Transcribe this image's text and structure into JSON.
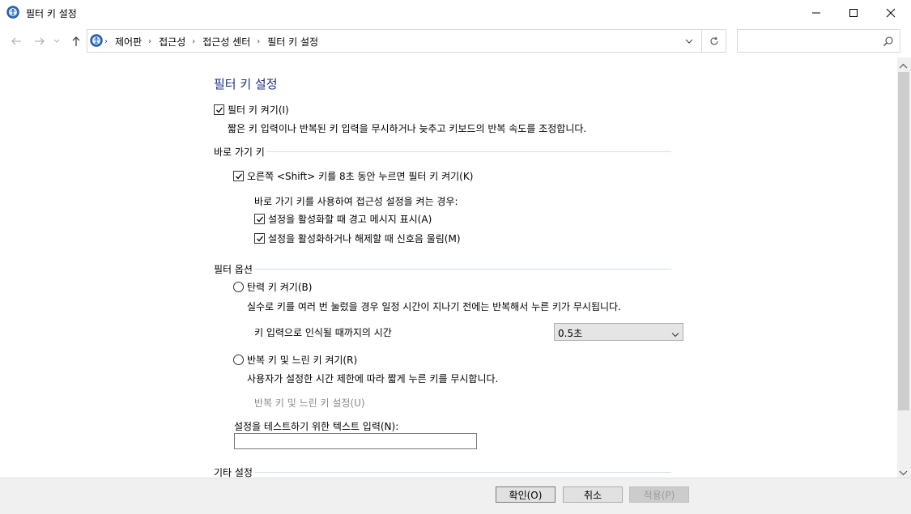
{
  "window": {
    "title": "필터 키 설정"
  },
  "address": {
    "crumbs": [
      "제어판",
      "접근성",
      "접근성 센터",
      "필터 키 설정"
    ],
    "search_placeholder": ""
  },
  "page": {
    "title": "필터 키 설정",
    "turn_on_filter_keys": {
      "label": "필터 키 켜기(I)",
      "checked": true
    },
    "description": "짧은 키 입력이나 반복된 키 입력을 무시하거나 늦추고 키보드의 반복 속도를 조정합니다.",
    "shortcut_group": {
      "heading": "바로 가기 키",
      "shift_option": {
        "label": "오른쪽 <Shift> 키를 8초 동안 누르면 필터 키 켜기(K)",
        "checked": true
      },
      "subheading": "바로 가기 키를 사용하여 접근성 설정을 켜는 경우:",
      "warning_option": {
        "label": "설정을 활성화할 때 경고 메시지 표시(A)",
        "checked": true
      },
      "sound_option": {
        "label": "설정을 활성화하거나 해제할 때 신호음 울림(M)",
        "checked": true
      }
    },
    "filter_group": {
      "heading": "필터 옵션",
      "bounce_option": {
        "label": "탄력 키 켜기(B)",
        "selected": false
      },
      "bounce_desc": "실수로 키를 여러 번 눌렀을 경우 일정 시간이 지나기 전에는 반복해서 누른 키가 무시됩니다.",
      "accept_time_label": "키 입력으로 인식될 때까지의 시간",
      "accept_time_value": "0.5초",
      "repeat_option": {
        "label": "반복 키 및 느린 키 켜기(R)",
        "selected": false
      },
      "repeat_desc": "사용자가 설정한 시간 제한에 따라 짧게 누른 키를 무시합니다.",
      "repeat_settings_link": "반복 키 및 느린 키 설정(U)",
      "test_label": "설정을 테스트하기 위한 텍스트 입력(N):",
      "test_value": ""
    },
    "other_group": {
      "heading": "기타 설정"
    }
  },
  "buttons": {
    "ok": "확인(O)",
    "cancel": "취소",
    "apply": "적용(P)"
  },
  "colors": {
    "title_blue": "#1e3287",
    "group_line": "#d5dfe5"
  }
}
